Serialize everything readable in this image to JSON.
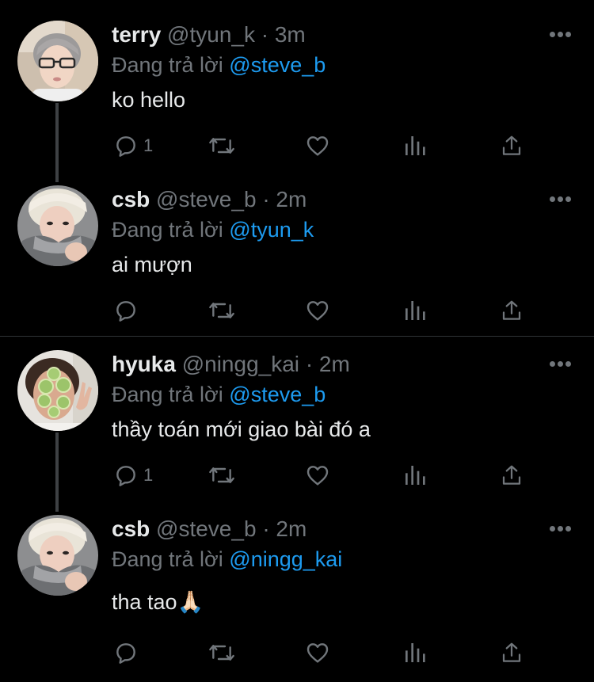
{
  "colors": {
    "background": "#000000",
    "text": "#e7e9ea",
    "secondary": "#71767b",
    "accent": "#1d9bf0",
    "divider": "#2f3336"
  },
  "tweets": [
    {
      "name": "terry",
      "handle": "@tyun_k",
      "separator": "·",
      "time": "3m",
      "replying_label": "Đang trả lời",
      "replying_to": "@steve_b",
      "text": "ko hello",
      "reply_count": "1",
      "avatar": "avatar-terry"
    },
    {
      "name": "csb",
      "handle": "@steve_b",
      "separator": "·",
      "time": "2m",
      "replying_label": "Đang trả lời",
      "replying_to": "@tyun_k",
      "text": "ai mượn",
      "reply_count": "",
      "avatar": "avatar-csb"
    },
    {
      "name": "hyuka",
      "handle": "@ningg_kai",
      "separator": "·",
      "time": "2m",
      "replying_label": "Đang trả lời",
      "replying_to": "@steve_b",
      "text": "thầy toán mới giao bài đó a",
      "reply_count": "1",
      "avatar": "avatar-hyuka"
    },
    {
      "name": "csb",
      "handle": "@steve_b",
      "separator": "·",
      "time": "2m",
      "replying_label": "Đang trả lời",
      "replying_to": "@ningg_kai",
      "text": "tha tao",
      "emoji": "🙏🏻",
      "reply_count": "",
      "avatar": "avatar-csb"
    }
  ],
  "action_icons": [
    "reply-icon",
    "retweet-icon",
    "like-icon",
    "analytics-icon",
    "share-icon"
  ],
  "more_icon": "more-options-icon"
}
